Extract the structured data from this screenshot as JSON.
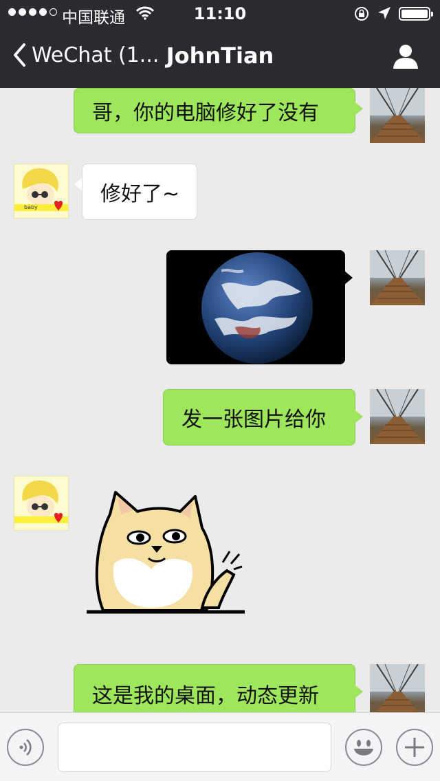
{
  "status_bar": {
    "carrier": "中国联通",
    "time": "11:10"
  },
  "nav": {
    "back_label": "WeChat (1...",
    "title": "JohnTian"
  },
  "messages": [
    {
      "from": "me",
      "type": "text",
      "text": "哥，你的电脑修好了没有"
    },
    {
      "from": "friend",
      "type": "text",
      "text": "修好了~"
    },
    {
      "from": "me",
      "type": "image",
      "icon": "earth-photo"
    },
    {
      "from": "me",
      "type": "text",
      "text": "发一张图片给你"
    },
    {
      "from": "friend",
      "type": "sticker",
      "icon": "shiba-dog-sticker"
    },
    {
      "from": "me",
      "type": "text",
      "text": "这是我的桌面，动态更新"
    }
  ],
  "friend_avatar_text": "baby",
  "colors": {
    "nav_bg": "#2b2b2f",
    "chat_bg": "#ebebeb",
    "my_bubble": "#9ee75d",
    "friend_bubble": "#ffffff"
  }
}
